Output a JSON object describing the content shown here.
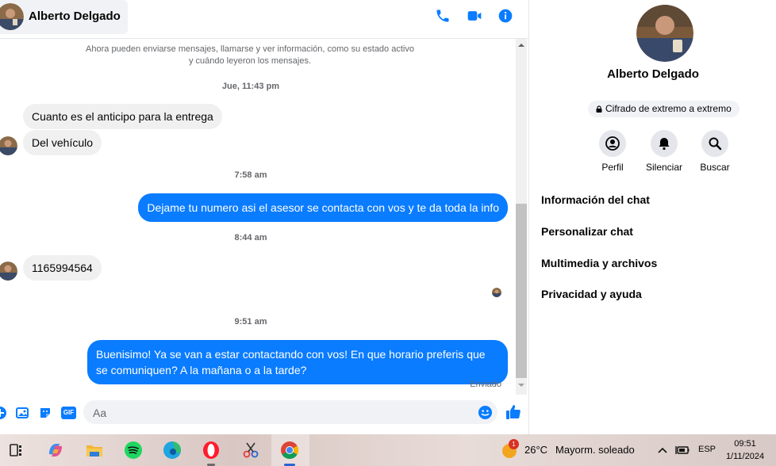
{
  "header": {
    "contact_name": "Alberto Delgado",
    "icons": [
      "phone-icon",
      "video-icon",
      "info-icon"
    ]
  },
  "notice": [
    "Ahora pueden enviarse mensajes, llamarse y ver información, como su estado activo",
    "y cuándo leyeron los mensajes."
  ],
  "timestamps": [
    "Jue, 11:43 pm",
    "7:58 am",
    "8:44 am",
    "9:51 am"
  ],
  "messages": [
    {
      "dir": "in",
      "text": "Cuanto es el anticipo para la entrega"
    },
    {
      "dir": "in",
      "text": "Del vehículo"
    },
    {
      "dir": "out",
      "text": "Dejame tu numero asi el asesor se contacta con vos y te da toda la info"
    },
    {
      "dir": "in",
      "text": "1165994564"
    },
    {
      "dir": "out",
      "text": "Buenisimo! Ya se van a estar contactando con vos! En que horario preferis que se comuniquen? A la mañana o a la tarde?"
    }
  ],
  "sent_status": "Enviado",
  "composer": {
    "placeholder": "Aa",
    "gif_label": "GIF"
  },
  "panel": {
    "name": "Alberto Delgado",
    "encryption": "Cifrado de extremo a extremo",
    "actions": [
      {
        "label": "Perfil",
        "icon": "profile-icon"
      },
      {
        "label": "Silenciar",
        "icon": "bell-icon"
      },
      {
        "label": "Buscar",
        "icon": "search-icon"
      }
    ],
    "menu": [
      "Información del chat",
      "Personalizar chat",
      "Multimedia y archivos",
      "Privacidad y ayuda"
    ]
  },
  "taskbar": {
    "weather_temp": "26°C",
    "weather_text": "Mayorm. soleado",
    "weather_badge": "1",
    "language": "ESP",
    "time": "09:51",
    "date": "1/11/2024"
  },
  "colors": {
    "accent": "#0a7cff",
    "incoming_bubble": "#f0f0f0"
  }
}
